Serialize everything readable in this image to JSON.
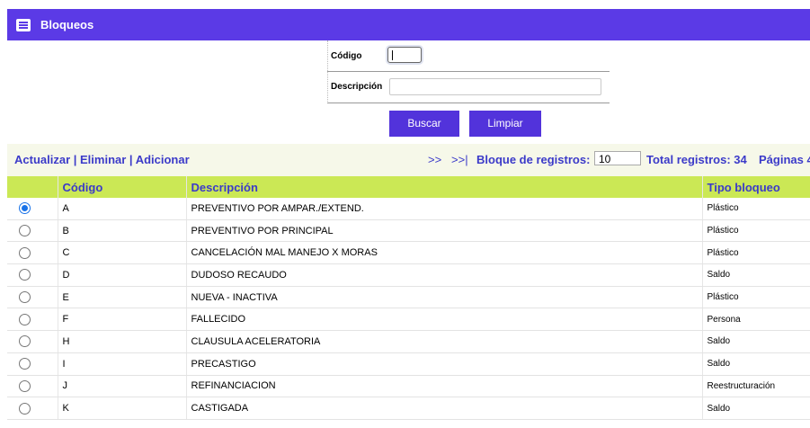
{
  "header": {
    "title": "Bloqueos",
    "icon": "list-icon"
  },
  "form": {
    "codigo_label": "Código",
    "codigo_value": "",
    "descripcion_label": "Descripción",
    "descripcion_value": "",
    "buscar_label": "Buscar",
    "limpiar_label": "Limpiar"
  },
  "toolbar": {
    "actualizar": "Actualizar",
    "sep1": " | ",
    "eliminar": "Eliminar",
    "sep2": " | ",
    "adicionar": "Adicionar",
    "next": ">>",
    "last": ">>|",
    "bloque_label": "Bloque de registros:",
    "bloque_value": "10",
    "total_label": "Total registros: 34",
    "paginas_label": "Páginas 4"
  },
  "table": {
    "columns": [
      "",
      "Código",
      "Descripción",
      "Tipo bloqueo"
    ],
    "rows": [
      {
        "codigo": "A",
        "descripcion": "PREVENTIVO POR AMPAR./EXTEND.",
        "tipo": "Plástico",
        "selected": true
      },
      {
        "codigo": "B",
        "descripcion": "PREVENTIVO POR PRINCIPAL",
        "tipo": "Plástico",
        "selected": false
      },
      {
        "codigo": "C",
        "descripcion": "CANCELACIÓN MAL MANEJO X MORAS",
        "tipo": "Plástico",
        "selected": false
      },
      {
        "codigo": "D",
        "descripcion": "DUDOSO RECAUDO",
        "tipo": "Saldo",
        "selected": false
      },
      {
        "codigo": "E",
        "descripcion": "NUEVA - INACTIVA",
        "tipo": "Plástico",
        "selected": false
      },
      {
        "codigo": "F",
        "descripcion": "FALLECIDO",
        "tipo": "Persona",
        "selected": false
      },
      {
        "codigo": "H",
        "descripcion": "CLAUSULA ACELERATORIA",
        "tipo": "Saldo",
        "selected": false
      },
      {
        "codigo": "I",
        "descripcion": "PRECASTIGO",
        "tipo": "Saldo",
        "selected": false
      },
      {
        "codigo": "J",
        "descripcion": "REFINANCIACION",
        "tipo": "Reestructuración",
        "selected": false
      },
      {
        "codigo": "K",
        "descripcion": "CASTIGADA",
        "tipo": "Saldo",
        "selected": false
      }
    ]
  },
  "colors": {
    "header": "#5b3ae6",
    "button": "#5233db",
    "table_header": "#cbe855",
    "link": "#3b3ac9"
  }
}
